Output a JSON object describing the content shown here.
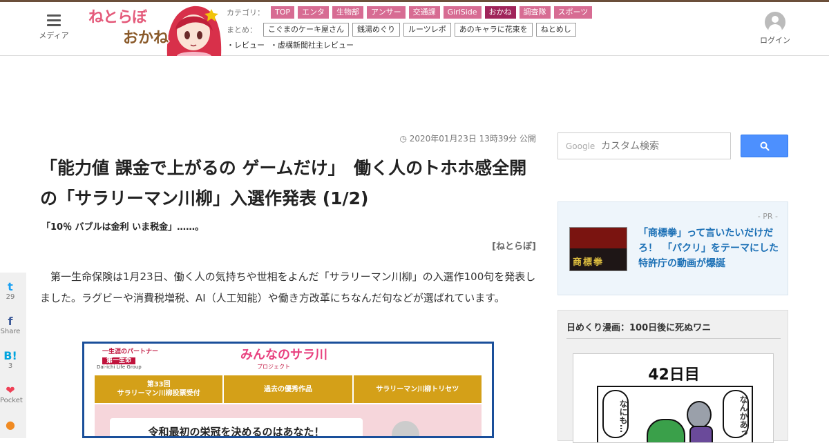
{
  "header": {
    "menu_label": "メディア",
    "logo_text": "ねとらぼ",
    "logo_sub": "おかね",
    "category_label": "カテゴリ：",
    "categories": [
      {
        "label": "TOP",
        "active": false
      },
      {
        "label": "エンタ",
        "active": false
      },
      {
        "label": "生物部",
        "active": false
      },
      {
        "label": "アンサー",
        "active": false
      },
      {
        "label": "交通課",
        "active": false
      },
      {
        "label": "GirlSide",
        "active": false
      },
      {
        "label": "おかね",
        "active": true
      },
      {
        "label": "調査隊",
        "active": false
      },
      {
        "label": "スポーツ",
        "active": false
      }
    ],
    "matome_label": "まとめ：",
    "matome": [
      "こぐまのケーキ屋さん",
      "銭湯めぐり",
      "ルーツレポ",
      "あのキャラに花束を",
      "ねとめし"
    ],
    "reviews": [
      "・レビュー",
      "・虚構新聞社主レビュー"
    ],
    "login_label": "ログイン"
  },
  "article": {
    "date": "2020年01月23日 13時39分 公開",
    "title": "「能力値 課金で上がるの ゲームだけ」　働く人のトホホ感全開の「サラリーマン川柳」入選作発表 (1/2)",
    "subtitle": "「10％ バブルは金利 いま税金」……。",
    "source": "[ねとらぼ]",
    "body": "第一生命保険は1月23日、働く人の気持ちや世相をよんだ「サラリーマン川柳」の入選作100句を発表しました。ラグビーや消費税増税、AI（人工知能）や働き方改革にちなんだ句などが選ばれています。"
  },
  "article_image": {
    "company_tagline": "一生涯のパートナー",
    "company_name": "第一生命",
    "company_en": "Dai-ichi Life Group",
    "logo_main": "みんなのサラ川",
    "logo_sub": "プロジェクト",
    "tabs": [
      {
        "line1": "第33回",
        "line2": "サラリーマン川柳投票受付"
      },
      {
        "line1": "過去の優秀作品",
        "line2": ""
      },
      {
        "line1": "サラリーマン川柳トリセツ",
        "line2": ""
      }
    ],
    "banner": "令和最初の栄冠を決めるのはあなた！"
  },
  "share": [
    {
      "icon": "twitter-icon",
      "glyph": "t",
      "count": "29",
      "color": "#1da1f2"
    },
    {
      "icon": "facebook-icon",
      "glyph": "f",
      "count": "Share",
      "color": "#3b5998"
    },
    {
      "icon": "hatena-icon",
      "glyph": "B!",
      "count": "3",
      "color": "#00a4de"
    },
    {
      "icon": "pocket-icon",
      "glyph": "❤",
      "count": "Pocket",
      "color": "#ef4056"
    },
    {
      "icon": "line-icon",
      "glyph": "●",
      "count": "",
      "color": "#f08a22"
    }
  ],
  "sidebar": {
    "search": {
      "google_label": "Google",
      "placeholder": "カスタム検索"
    },
    "pr": {
      "label": "- PR -",
      "thumb_text": "商標拳",
      "text": "「商標拳」って言いたいだけだろ！　「パクリ」をテーマにした特許庁の動画が爆誕"
    },
    "manga": {
      "title": "日めくり漫画：100日後に死ぬワニ",
      "day": "42日目",
      "bubble_left": "なにも…",
      "bubble_right": "なんかあっ"
    }
  },
  "colors": {
    "category_tag": "#d76c93",
    "category_active": "#a0245a",
    "link_blue": "#1a6fb5",
    "search_button": "#4d90fe"
  }
}
